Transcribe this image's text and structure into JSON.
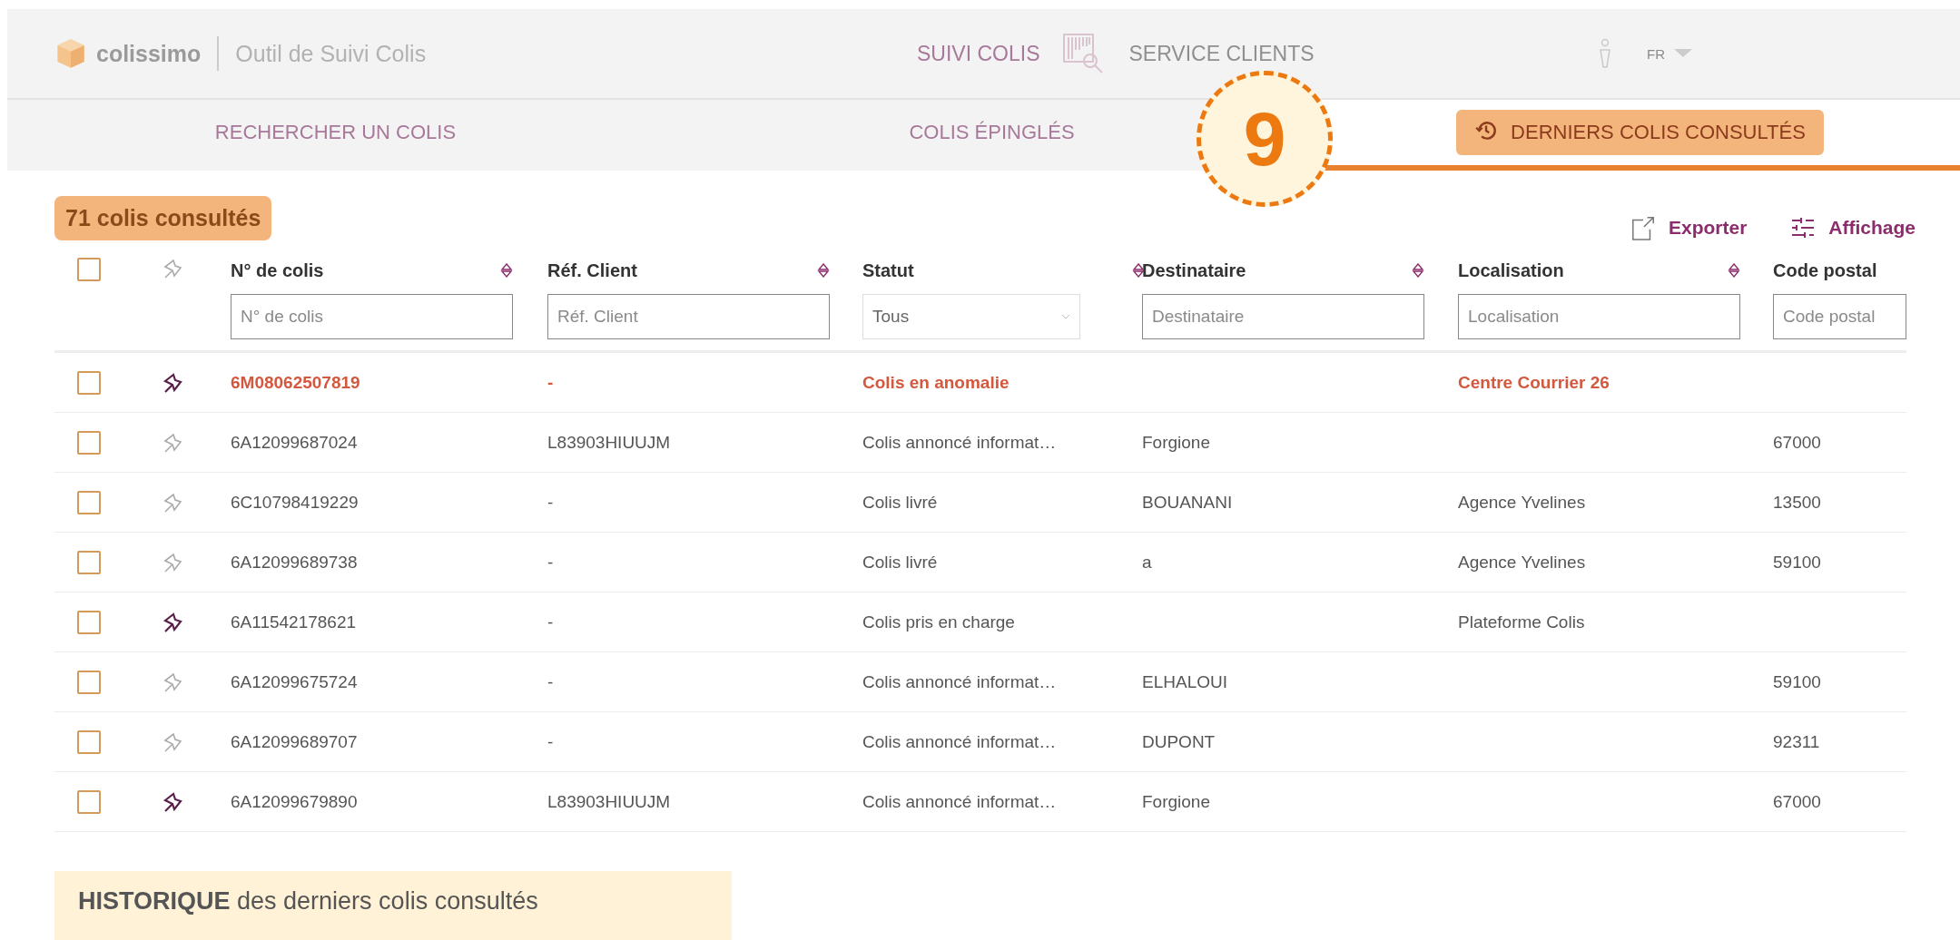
{
  "header": {
    "brand": "colissimo",
    "app_title": "Outil de Suivi Colis",
    "nav": [
      {
        "label": "SUIVI COLIS",
        "kind": "text"
      },
      {
        "label": "SERVICE CLIENTS",
        "kind": "text"
      }
    ],
    "language": "FR"
  },
  "tabs": [
    {
      "label": "RECHERCHER UN COLIS",
      "selected": false,
      "highlighted": false
    },
    {
      "label": "COLIS ÉPINGLÉS",
      "selected": false,
      "highlighted": false
    },
    {
      "label": "DERNIERS COLIS CONSULTÉS",
      "selected": true,
      "highlighted": true
    }
  ],
  "callout_badge": "9",
  "count": {
    "text": "71 colis consultés",
    "highlighted": true
  },
  "actions": [
    {
      "label": "Exporter",
      "kind": "export"
    },
    {
      "label": "Affichage",
      "kind": "display"
    }
  ],
  "table": {
    "all_checked": false,
    "columns": [
      {
        "label": "N° de colis",
        "sortable": true,
        "filter": {
          "kind": "input",
          "placeholder": "N° de colis"
        }
      },
      {
        "label": "Réf. Client",
        "sortable": true,
        "filter": {
          "kind": "input",
          "placeholder": "Réf. Client"
        }
      },
      {
        "label": "Statut",
        "sortable": true,
        "filter": {
          "kind": "select",
          "value": "Tous"
        }
      },
      {
        "label": "Destinataire",
        "sortable": true,
        "filter": {
          "kind": "input",
          "placeholder": "Destinataire"
        }
      },
      {
        "label": "Localisation",
        "sortable": true,
        "filter": {
          "kind": "input",
          "placeholder": "Localisation"
        }
      },
      {
        "label": "Code postal",
        "sortable": false,
        "filter": {
          "kind": "input",
          "placeholder": "Code postal"
        }
      }
    ],
    "rows": [
      {
        "checked": false,
        "pinned": true,
        "anomaly": true,
        "cells": [
          "6M08062507819",
          "-",
          "Colis en anomalie",
          "",
          "Centre Courrier 26",
          ""
        ]
      },
      {
        "checked": false,
        "pinned": false,
        "anomaly": false,
        "cells": [
          "6A12099687024",
          "L83903HIUUJM",
          "Colis annoncé informat…",
          "Forgione",
          "",
          "67000"
        ]
      },
      {
        "checked": false,
        "pinned": false,
        "anomaly": false,
        "cells": [
          "6C10798419229",
          "-",
          "Colis livré",
          "BOUANANI",
          "Agence Yvelines",
          "13500"
        ]
      },
      {
        "checked": false,
        "pinned": false,
        "anomaly": false,
        "cells": [
          "6A12099689738",
          "-",
          "Colis livré",
          "a",
          "Agence Yvelines",
          "59100"
        ]
      },
      {
        "checked": false,
        "pinned": true,
        "anomaly": false,
        "cells": [
          "6A11542178621",
          "-",
          "Colis pris en charge",
          "",
          "Plateforme Colis",
          ""
        ]
      },
      {
        "checked": false,
        "pinned": false,
        "anomaly": false,
        "cells": [
          "6A12099675724",
          "-",
          "Colis annoncé informat…",
          "ELHALOUI",
          "",
          "59100"
        ]
      },
      {
        "checked": false,
        "pinned": false,
        "anomaly": false,
        "cells": [
          "6A12099689707",
          "-",
          "Colis annoncé informat…",
          "DUPONT",
          "",
          "92311"
        ]
      },
      {
        "checked": false,
        "pinned": true,
        "anomaly": false,
        "cells": [
          "6A12099679890",
          "L83903HIUUJM",
          "Colis annoncé informat…",
          "Forgione",
          "",
          "67000"
        ]
      }
    ]
  },
  "caption": "**HISTORIQUE** des derniers colis consultés"
}
